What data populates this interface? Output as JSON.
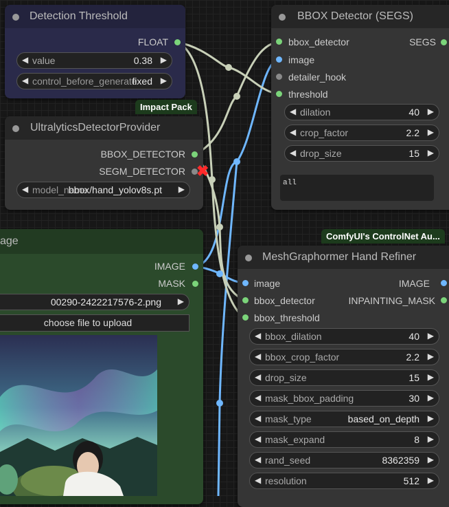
{
  "detection_threshold": {
    "title": "Detection Threshold",
    "output": "FLOAT",
    "widgets": [
      {
        "name": "value",
        "value": "0.38"
      },
      {
        "name": "control_before_generate",
        "value": "fixed"
      }
    ]
  },
  "ultralytics": {
    "tag": "Impact Pack",
    "title": "UltralyticsDetectorProvider",
    "outputs": [
      "BBOX_DETECTOR",
      "SEGM_DETECTOR"
    ],
    "model_name_label": "model_name",
    "model_name_value": "bbox/hand_yolov8s.pt"
  },
  "bbox_detector": {
    "title": "BBOX Detector (SEGS)",
    "inputs": [
      "bbox_detector",
      "image",
      "detailer_hook",
      "threshold"
    ],
    "output": "SEGS",
    "widgets": [
      {
        "name": "dilation",
        "value": "40"
      },
      {
        "name": "crop_factor",
        "value": "2.2"
      },
      {
        "name": "drop_size",
        "value": "15"
      }
    ],
    "labels_text": "all"
  },
  "load_image": {
    "title_partial": "age",
    "outputs": [
      "IMAGE",
      "MASK"
    ],
    "filename": "00290-2422217576-2.png",
    "upload_label": "choose file to upload"
  },
  "mesh_refiner": {
    "tag": "ComfyUI's ControlNet Au...",
    "title": "MeshGraphormer Hand Refiner",
    "inputs": [
      "image",
      "bbox_detector",
      "bbox_threshold"
    ],
    "outputs": [
      "IMAGE",
      "INPAINTING_MASK"
    ],
    "widgets": [
      {
        "name": "bbox_dilation",
        "value": "40"
      },
      {
        "name": "bbox_crop_factor",
        "value": "2.2"
      },
      {
        "name": "drop_size",
        "value": "15"
      },
      {
        "name": "mask_bbox_padding",
        "value": "30"
      },
      {
        "name": "mask_type",
        "value": "based_on_depth"
      },
      {
        "name": "mask_expand",
        "value": "8"
      },
      {
        "name": "rand_seed",
        "value": "8362359"
      },
      {
        "name": "resolution",
        "value": "512"
      }
    ]
  },
  "colors": {
    "image_wire": "#6fb7ff",
    "link_wire": "#c8d0b8",
    "pin_green": "#7bd47a",
    "tag_bg": "#1d3b1d",
    "threshold_node_bg": "#2a2a4a"
  }
}
